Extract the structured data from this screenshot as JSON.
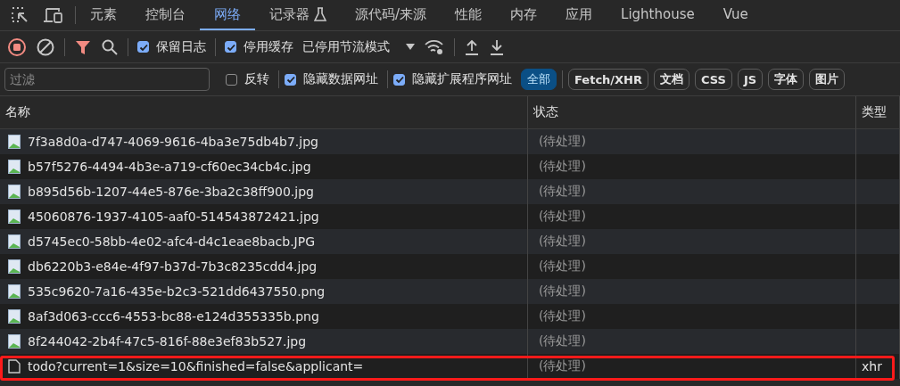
{
  "panel_tabs": [
    {
      "label": "元素",
      "selected": false,
      "icon": false
    },
    {
      "label": "控制台",
      "selected": false,
      "icon": false
    },
    {
      "label": "网络",
      "selected": true,
      "icon": false
    },
    {
      "label": "记录器",
      "selected": false,
      "icon": true
    },
    {
      "label": "源代码/来源",
      "selected": false,
      "icon": false
    },
    {
      "label": "性能",
      "selected": false,
      "icon": false
    },
    {
      "label": "内存",
      "selected": false,
      "icon": false
    },
    {
      "label": "应用",
      "selected": false,
      "icon": false
    },
    {
      "label": "Lighthouse",
      "selected": false,
      "icon": false
    },
    {
      "label": "Vue",
      "selected": false,
      "icon": false
    }
  ],
  "toolbar": {
    "preserve_log": {
      "label": "保留日志",
      "checked": true
    },
    "disable_cache": {
      "label": "停用缓存",
      "checked": true
    },
    "throttling": "已停用节流模式"
  },
  "filter_bar": {
    "placeholder": "过滤",
    "options": [
      {
        "label": "反转",
        "checked": false
      },
      {
        "label": "隐藏数据网址",
        "checked": true
      },
      {
        "label": "隐藏扩展程序网址",
        "checked": true
      }
    ],
    "types": [
      {
        "label": "全部",
        "selected": true
      },
      {
        "label": "Fetch/XHR",
        "selected": false
      },
      {
        "label": "文档",
        "selected": false
      },
      {
        "label": "CSS",
        "selected": false
      },
      {
        "label": "JS",
        "selected": false
      },
      {
        "label": "字体",
        "selected": false
      },
      {
        "label": "图片",
        "selected": false
      }
    ]
  },
  "table": {
    "columns": [
      "名称",
      "状态",
      "类型"
    ],
    "rows": [
      {
        "kind": "image",
        "name": "7f3a8d0a-d747-4069-9616-4ba3e75db4b7.jpg",
        "status": "(待处理)"
      },
      {
        "kind": "image",
        "name": "b57f5276-4494-4b3e-a719-cf60ec34cb4c.jpg",
        "status": "(待处理)"
      },
      {
        "kind": "image",
        "name": "b895d56b-1207-44e5-876e-3ba2c38ff900.jpg",
        "status": "(待处理)"
      },
      {
        "kind": "image",
        "name": "45060876-1937-4105-aaf0-514543872421.jpg",
        "status": "(待处理)"
      },
      {
        "kind": "image",
        "name": "d5745ec0-58bb-4e02-afc4-d4c1eae8bacb.JPG",
        "status": "(待处理)"
      },
      {
        "kind": "image",
        "name": "db6220b3-e84e-4f97-b37d-7b3c8235cdd4.jpg",
        "status": "(待处理)"
      },
      {
        "kind": "image",
        "name": "535c9620-7a16-435e-b2c3-521dd6437550.png",
        "status": "(待处理)"
      },
      {
        "kind": "image",
        "name": "8af3d063-ccc6-4553-bc88-e124d355335b.png",
        "status": "(待处理)"
      },
      {
        "kind": "image",
        "name": "8f244042-2b4f-47c5-816f-88e3ef83b527.jpg",
        "status": "(待处理)"
      },
      {
        "kind": "document",
        "name": "todo?current=1&size=10&finished=false&applicant=",
        "status": "(待处理)",
        "type": "xhr",
        "highlighted": true
      }
    ]
  }
}
